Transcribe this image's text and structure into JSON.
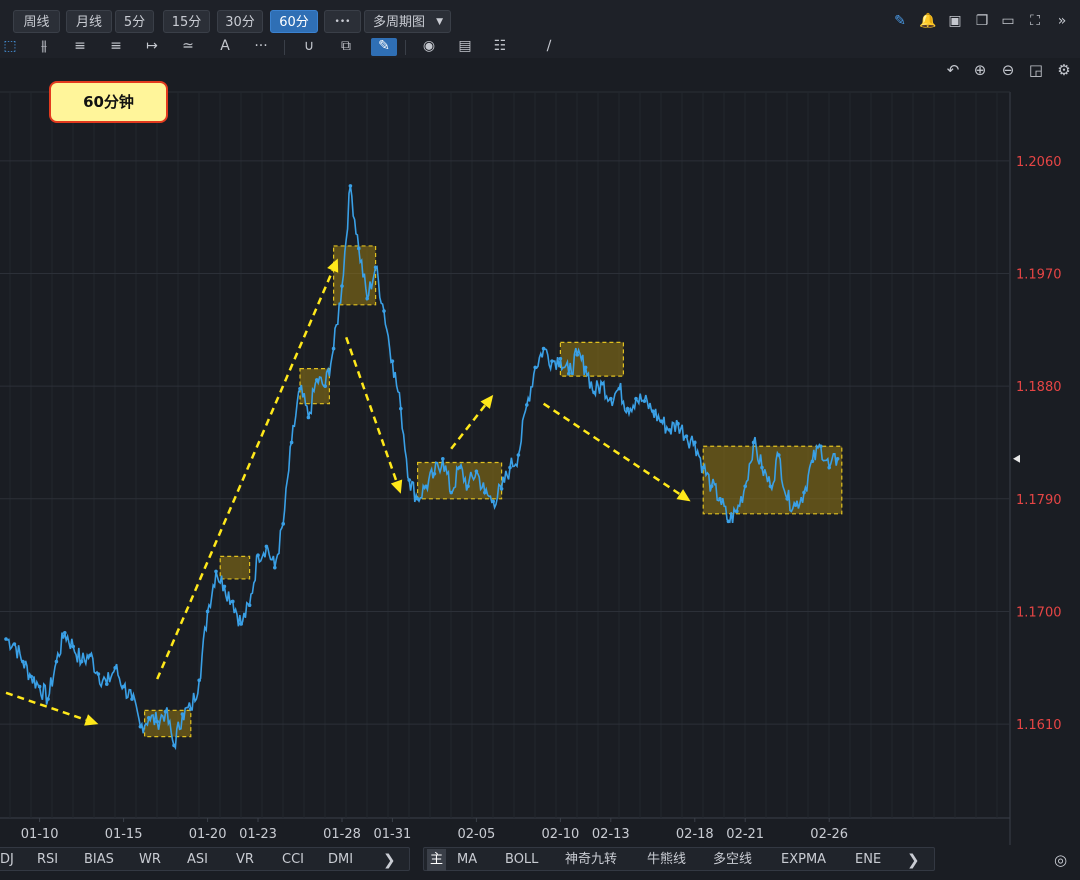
{
  "toolbar": {
    "periods": [
      {
        "label": "周线",
        "active": false
      },
      {
        "label": "月线",
        "active": false
      },
      {
        "label": "5分",
        "active": false
      },
      {
        "label": "15分",
        "active": false
      },
      {
        "label": "30分",
        "active": false
      },
      {
        "label": "60分",
        "active": true
      }
    ],
    "more_label": "•••",
    "multi_period_label": "多周期图",
    "tool_text_icon": "A",
    "tool_more": "···"
  },
  "annotation_label": "60分钟",
  "indicators_left": [
    "DJ",
    "RSI",
    "BIAS",
    "WR",
    "ASI",
    "VR",
    "CCI",
    "DMI"
  ],
  "indicators_right": [
    "主",
    "MA",
    "BOLL",
    "神奇九转",
    "牛熊线",
    "多空线",
    "EXPMA",
    "ENE"
  ],
  "colors": {
    "background": "#1a1d23",
    "price_line": "#3aa0e6",
    "price_label": "#e64545",
    "box_fill": "rgba(150,120,20,0.55)",
    "box_border": "#e0c020",
    "arrow": "#ffe81a",
    "active_button": "#2f6fb5"
  },
  "chart_data": {
    "type": "line",
    "x_ticks": [
      "01-10",
      "01-15",
      "01-20",
      "01-23",
      "01-28",
      "01-31",
      "02-05",
      "02-10",
      "02-13",
      "02-18",
      "02-21",
      "02-26"
    ],
    "y_ticks": [
      "1.2060",
      "1.1970",
      "1.1880",
      "1.1790",
      "1.1700",
      "1.1610"
    ],
    "ylim": [
      1.1535,
      1.2115
    ],
    "grid": true,
    "series": [
      {
        "points": [
          [
            "01-08 00:00",
            1.1678
          ],
          [
            "01-08 12:00",
            1.1674
          ],
          [
            "01-09 00:00",
            1.166
          ],
          [
            "01-09 12:00",
            1.1648
          ],
          [
            "01-10 00:00",
            1.164
          ],
          [
            "01-10 12:00",
            1.163
          ],
          [
            "01-11 00:00",
            1.166
          ],
          [
            "01-11 12:00",
            1.1683
          ],
          [
            "01-12 00:00",
            1.1672
          ],
          [
            "01-12 12:00",
            1.166
          ],
          [
            "01-13 00:00",
            1.1665
          ],
          [
            "01-13 12:00",
            1.165
          ],
          [
            "01-14 00:00",
            1.1642
          ],
          [
            "01-14 12:00",
            1.1655
          ],
          [
            "01-15 00:00",
            1.164
          ],
          [
            "01-15 12:00",
            1.163
          ],
          [
            "01-16 00:00",
            1.1608
          ],
          [
            "01-16 12:00",
            1.1615
          ],
          [
            "01-17 00:00",
            1.1612
          ],
          [
            "01-17 12:00",
            1.162
          ],
          [
            "01-18 00:00",
            1.1593
          ],
          [
            "01-18 12:00",
            1.1618
          ],
          [
            "01-19 00:00",
            1.1622
          ],
          [
            "01-19 12:00",
            1.1645
          ],
          [
            "01-20 00:00",
            1.17
          ],
          [
            "01-20 12:00",
            1.1732
          ],
          [
            "01-21 00:00",
            1.172
          ],
          [
            "01-21 12:00",
            1.1708
          ],
          [
            "01-22 00:00",
            1.169
          ],
          [
            "01-22 12:00",
            1.1705
          ],
          [
            "01-23 00:00",
            1.1745
          ],
          [
            "01-23 12:00",
            1.1752
          ],
          [
            "01-24 00:00",
            1.1735
          ],
          [
            "01-24 12:00",
            1.177
          ],
          [
            "01-25 00:00",
            1.1835
          ],
          [
            "01-25 12:00",
            1.1878
          ],
          [
            "01-26 00:00",
            1.1855
          ],
          [
            "01-26 12:00",
            1.1885
          ],
          [
            "01-27 00:00",
            1.188
          ],
          [
            "01-27 12:00",
            1.191
          ],
          [
            "01-28 00:00",
            1.196
          ],
          [
            "01-28 12:00",
            1.204
          ],
          [
            "01-29 00:00",
            1.199
          ],
          [
            "01-29 12:00",
            1.195
          ],
          [
            "01-30 00:00",
            1.1975
          ],
          [
            "01-30 12:00",
            1.194
          ],
          [
            "01-31 00:00",
            1.19
          ],
          [
            "01-31 12:00",
            1.1862
          ],
          [
            "02-01 00:00",
            1.1805
          ],
          [
            "02-01 12:00",
            1.179
          ],
          [
            "02-02 00:00",
            1.18
          ],
          [
            "02-02 12:00",
            1.181
          ],
          [
            "02-03 00:00",
            1.1822
          ],
          [
            "02-03 12:00",
            1.1795
          ],
          [
            "02-04 00:00",
            1.1815
          ],
          [
            "02-04 12:00",
            1.18
          ],
          [
            "02-05 00:00",
            1.1812
          ],
          [
            "02-05 12:00",
            1.1795
          ],
          [
            "02-06 00:00",
            1.1788
          ],
          [
            "02-06 12:00",
            1.1798
          ],
          [
            "02-07 00:00",
            1.1815
          ],
          [
            "02-07 12:00",
            1.1825
          ],
          [
            "02-08 00:00",
            1.1865
          ],
          [
            "02-08 12:00",
            1.1895
          ],
          [
            "02-09 00:00",
            1.191
          ],
          [
            "02-09 12:00",
            1.19
          ],
          [
            "02-10 00:00",
            1.1902
          ],
          [
            "02-10 12:00",
            1.189
          ],
          [
            "02-11 00:00",
            1.1905
          ],
          [
            "02-11 12:00",
            1.1895
          ],
          [
            "02-12 00:00",
            1.1875
          ],
          [
            "02-12 12:00",
            1.1882
          ],
          [
            "02-13 00:00",
            1.187
          ],
          [
            "02-13 12:00",
            1.1878
          ],
          [
            "02-14 00:00",
            1.1862
          ],
          [
            "02-14 12:00",
            1.187
          ],
          [
            "02-15 00:00",
            1.1868
          ],
          [
            "02-15 12:00",
            1.186
          ],
          [
            "02-16 00:00",
            1.1852
          ],
          [
            "02-16 12:00",
            1.1845
          ],
          [
            "02-17 00:00",
            1.185
          ],
          [
            "02-17 12:00",
            1.184
          ],
          [
            "02-18 00:00",
            1.1835
          ],
          [
            "02-18 12:00",
            1.1815
          ],
          [
            "02-19 00:00",
            1.18
          ],
          [
            "02-19 12:00",
            1.179
          ],
          [
            "02-20 00:00",
            1.1772
          ],
          [
            "02-20 12:00",
            1.178
          ],
          [
            "02-21 00:00",
            1.18
          ],
          [
            "02-21 12:00",
            1.1835
          ],
          [
            "02-22 00:00",
            1.1815
          ],
          [
            "02-22 12:00",
            1.18
          ],
          [
            "02-23 00:00",
            1.1825
          ],
          [
            "02-23 12:00",
            1.179
          ],
          [
            "02-24 00:00",
            1.1785
          ],
          [
            "02-24 12:00",
            1.1795
          ],
          [
            "02-25 00:00",
            1.182
          ],
          [
            "02-25 12:00",
            1.1832
          ],
          [
            "02-26 00:00",
            1.1815
          ],
          [
            "02-26 12:00",
            1.1822
          ]
        ]
      }
    ],
    "consolidation_boxes": [
      {
        "x0": "01-16 06:00",
        "x1": "01-19 00:00",
        "y0": 1.16,
        "y1": 1.1621
      },
      {
        "x0": "01-20 18:00",
        "x1": "01-22 12:00",
        "y0": 1.1726,
        "y1": 1.1744
      },
      {
        "x0": "01-25 12:00",
        "x1": "01-27 06:00",
        "y0": 1.1866,
        "y1": 1.1894
      },
      {
        "x0": "01-27 12:00",
        "x1": "01-30 00:00",
        "y0": 1.1945,
        "y1": 1.1992
      },
      {
        "x0": "02-01 12:00",
        "x1": "02-06 12:00",
        "y0": 1.179,
        "y1": 1.1819
      },
      {
        "x0": "02-10 00:00",
        "x1": "02-13 18:00",
        "y0": 1.1888,
        "y1": 1.1915
      },
      {
        "x0": "02-18 12:00",
        "x1": "02-26 18:00",
        "y0": 1.1778,
        "y1": 1.1832
      }
    ],
    "trend_arrows": [
      {
        "from": [
          "01-08 00:00",
          1.1635
        ],
        "to": [
          "01-13 12:00",
          1.161
        ]
      },
      {
        "from": [
          "01-17 00:00",
          1.1646
        ],
        "to": [
          "01-27 18:00",
          1.1982
        ]
      },
      {
        "from": [
          "01-28 06:00",
          1.1919
        ],
        "to": [
          "01-31 12:00",
          1.1794
        ]
      },
      {
        "from": [
          "02-03 12:00",
          1.183
        ],
        "to": [
          "02-06 00:00",
          1.1873
        ]
      },
      {
        "from": [
          "02-09 00:00",
          1.1866
        ],
        "to": [
          "02-17 18:00",
          1.1788
        ]
      }
    ]
  }
}
